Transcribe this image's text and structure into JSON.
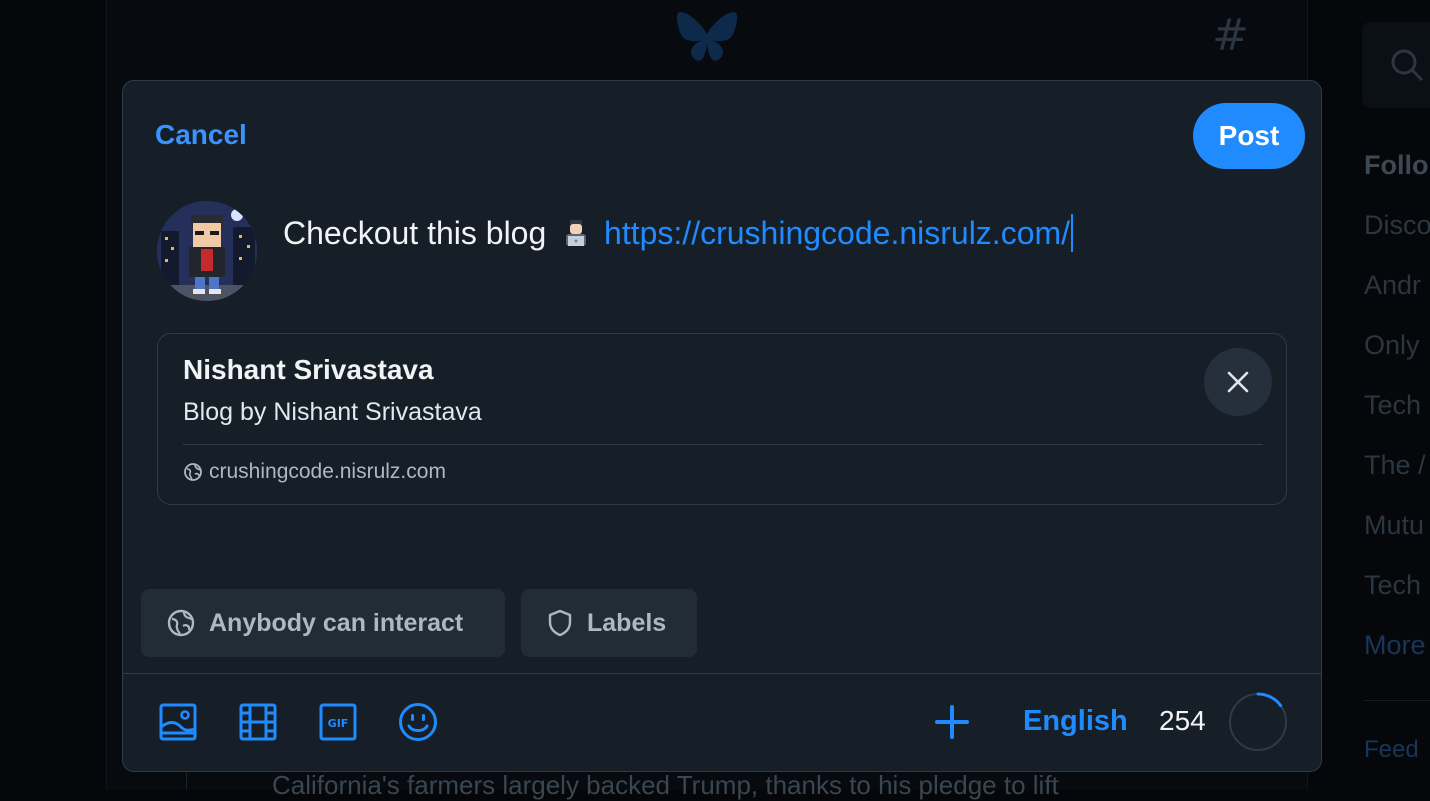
{
  "dialog": {
    "cancel_label": "Cancel",
    "post_label": "Post",
    "composer": {
      "text": "Checkout this blog",
      "emoji": "technologist-emoji",
      "link": "https://crushingcode.nisrulz.com/"
    },
    "link_card": {
      "title": "Nishant Srivastava",
      "description": "Blog by Nishant Srivastava",
      "domain": "crushingcode.nisrulz.com"
    },
    "chips": {
      "interaction": "Anybody can interact",
      "labels": "Labels"
    },
    "toolbar": {
      "icons": [
        "image-icon",
        "video-icon",
        "gif-icon",
        "emoji-icon",
        "plus-icon"
      ],
      "language": "English",
      "remaining_chars": "254",
      "char_progress": 0.15
    }
  },
  "background": {
    "right_sidebar": {
      "title": "Follo",
      "items": [
        "Disco",
        "Andr",
        "Only",
        "Tech",
        "The /",
        "Mutu",
        "Tech"
      ],
      "more": "More",
      "feedback": "Feed"
    },
    "feed_snippet": "California's farmers largely backed Trump, thanks to his pledge to lift"
  },
  "colors": {
    "accent": "#208bfe",
    "dialog_bg": "#161e27",
    "border": "#2e3b49",
    "text": "#f1f3f5",
    "muted": "#aeb8c3"
  }
}
